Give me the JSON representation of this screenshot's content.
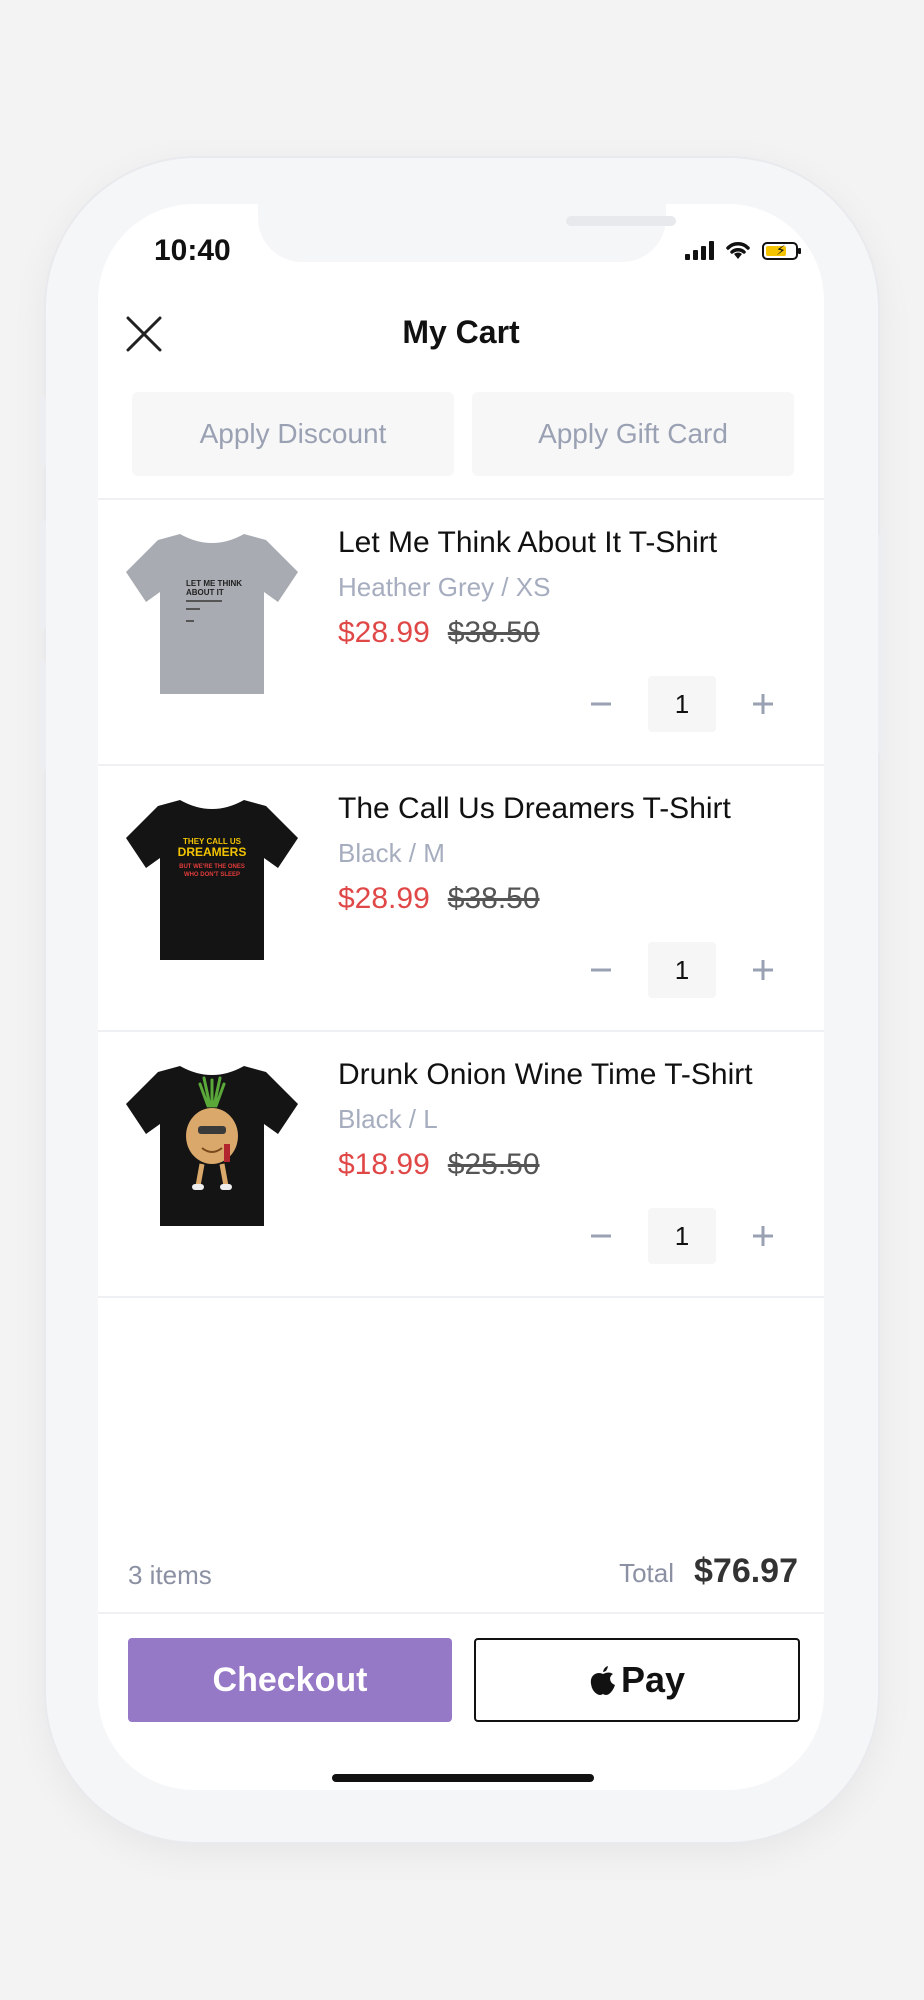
{
  "status_bar": {
    "time": "10:40"
  },
  "header": {
    "title": "My Cart"
  },
  "actions": {
    "discount_label": "Apply Discount",
    "gift_card_label": "Apply Gift Card"
  },
  "items": [
    {
      "name": "Let Me Think About It T-Shirt",
      "variant": "Heather Grey / XS",
      "price": "$28.99",
      "original_price": "$38.50",
      "qty": "1",
      "shirt_color": "#a8abb1",
      "print_text": "LET ME THINK ABOUT IT"
    },
    {
      "name": "The Call Us Dreamers T-Shirt",
      "variant": "Black / M",
      "price": "$28.99",
      "original_price": "$38.50",
      "qty": "1",
      "shirt_color": "#141414",
      "print_text": "THEY CALL US DREAMERS BUT WE'RE THE ONES WHO DON'T SLEEP"
    },
    {
      "name": "Drunk Onion Wine Time T-Shirt",
      "variant": "Black / L",
      "price": "$18.99",
      "original_price": "$25.50",
      "qty": "1",
      "shirt_color": "#141414"
    }
  ],
  "summary": {
    "count": "3 items",
    "total_label": "Total",
    "total": "$76.97"
  },
  "footer": {
    "checkout_label": "Checkout",
    "apple_pay_label": "Pay"
  },
  "colors": {
    "accent": "#9578c6",
    "sale": "#e04848"
  }
}
